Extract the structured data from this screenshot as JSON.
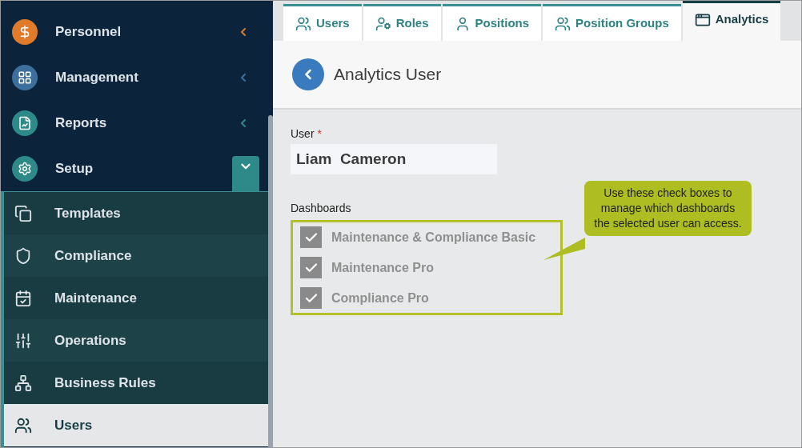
{
  "sidebar": {
    "items": [
      {
        "label": "Personnel",
        "color": "#e07b2a",
        "expanded": false
      },
      {
        "label": "Management",
        "color": "#3d6f9c",
        "expanded": false
      },
      {
        "label": "Reports",
        "color": "#2e8a89",
        "expanded": false
      },
      {
        "label": "Setup",
        "color": "#2e8a89",
        "expanded": true
      }
    ],
    "sub_items": [
      {
        "label": "Templates",
        "selected": false
      },
      {
        "label": "Compliance",
        "selected": false
      },
      {
        "label": "Maintenance",
        "selected": false
      },
      {
        "label": "Operations",
        "selected": false
      },
      {
        "label": "Business Rules",
        "selected": false
      },
      {
        "label": "Users",
        "selected": true
      }
    ]
  },
  "tabs": [
    {
      "label": "Users",
      "selected": false
    },
    {
      "label": "Roles",
      "selected": false
    },
    {
      "label": "Positions",
      "selected": false
    },
    {
      "label": "Position Groups",
      "selected": false
    },
    {
      "label": "Analytics",
      "selected": true
    }
  ],
  "page_title": "Analytics User",
  "user_field": {
    "label": "User",
    "required_mark": "*",
    "value": "Liam  Cameron"
  },
  "dashboards": {
    "label": "Dashboards",
    "items": [
      {
        "label": "Maintenance & Compliance Basic",
        "checked": true,
        "disabled": true
      },
      {
        "label": "Maintenance Pro",
        "checked": true,
        "disabled": true
      },
      {
        "label": "Compliance Pro",
        "checked": true,
        "disabled": true
      }
    ]
  },
  "callout": {
    "text": "Use these check boxes to manage which dashboards the selected user can access."
  }
}
